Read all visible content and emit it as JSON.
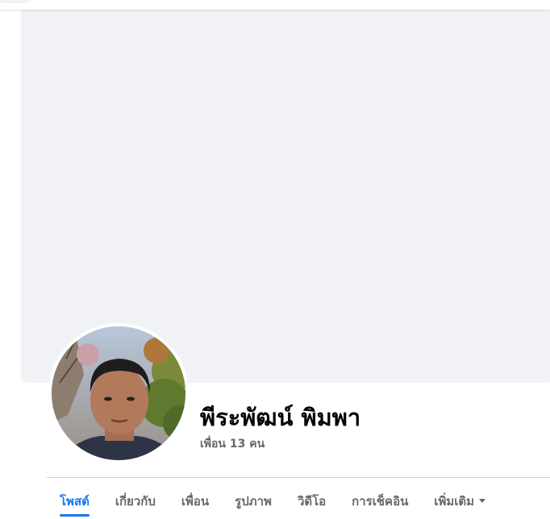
{
  "profile": {
    "name": "พีระพัฒน์ พิมพา",
    "friends": "เพื่อน 13 คน"
  },
  "tabs": [
    {
      "label": "โพสต์",
      "active": true
    },
    {
      "label": "เกี่ยวกับ",
      "active": false
    },
    {
      "label": "เพื่อน",
      "active": false
    },
    {
      "label": "รูปภาพ",
      "active": false
    },
    {
      "label": "วิดีโอ",
      "active": false
    },
    {
      "label": "การเช็คอิน",
      "active": false
    },
    {
      "label": "เพิ่มเติม",
      "active": false
    }
  ],
  "colors": {
    "accent": "#1877f2",
    "cover_bg": "#f0f2f5",
    "secondary_text": "#65676b"
  },
  "icons": {
    "more_tab": "caret-down-icon"
  }
}
